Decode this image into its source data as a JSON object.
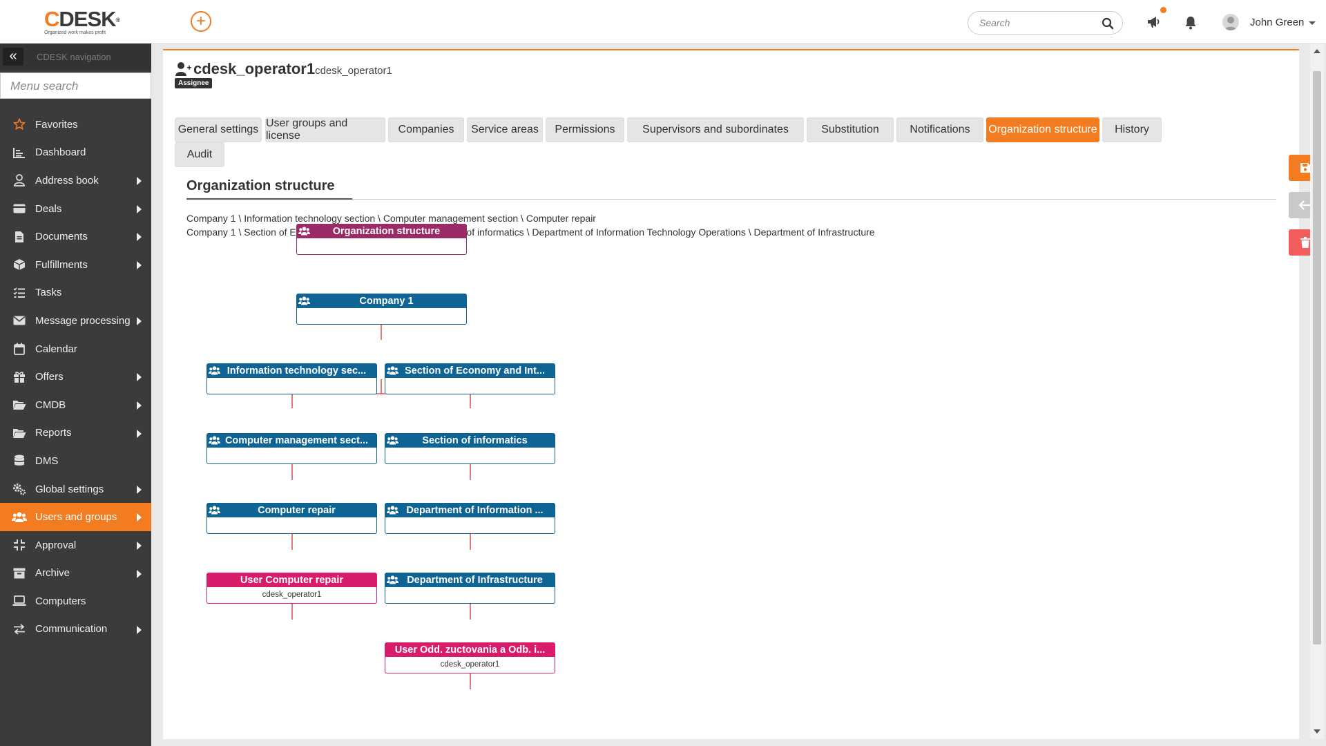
{
  "app": {
    "logo_text": "CDESK",
    "logo_tagline": "Organized work makes profit",
    "add_label": "+"
  },
  "topbar": {
    "search_placeholder": "Search",
    "user_name": "John Green",
    "icons": [
      "search-icon",
      "megaphone-icon",
      "bell-icon",
      "avatar"
    ]
  },
  "sidebar": {
    "toggle_label": "«",
    "nav_title": "CDESK navigation",
    "menu_search_placeholder": "Menu search",
    "items": [
      {
        "label": "Favorites",
        "icon": "star-icon",
        "has_submenu": false
      },
      {
        "label": "Dashboard",
        "icon": "dashboard-icon",
        "has_submenu": false
      },
      {
        "label": "Address book",
        "icon": "person-icon",
        "has_submenu": true
      },
      {
        "label": "Deals",
        "icon": "card-icon",
        "has_submenu": true
      },
      {
        "label": "Documents",
        "icon": "document-icon",
        "has_submenu": true
      },
      {
        "label": "Fulfillments",
        "icon": "box-icon",
        "has_submenu": true
      },
      {
        "label": "Tasks",
        "icon": "tasks-icon",
        "has_submenu": false
      },
      {
        "label": "Message processing",
        "icon": "envelope-icon",
        "has_submenu": true
      },
      {
        "label": "Calendar",
        "icon": "calendar-icon",
        "has_submenu": false
      },
      {
        "label": "Offers",
        "icon": "gift-icon",
        "has_submenu": true
      },
      {
        "label": "CMDB",
        "icon": "folder-open-icon",
        "has_submenu": true
      },
      {
        "label": "Reports",
        "icon": "folder-open-icon",
        "has_submenu": true
      },
      {
        "label": "DMS",
        "icon": "database-icon",
        "has_submenu": false
      },
      {
        "label": "Global settings",
        "icon": "gears-icon",
        "has_submenu": true
      },
      {
        "label": "Users and groups",
        "icon": "users-icon",
        "has_submenu": true,
        "active": true
      },
      {
        "label": "Approval",
        "icon": "compress-icon",
        "has_submenu": true
      },
      {
        "label": "Archive",
        "icon": "archive-icon",
        "has_submenu": true
      },
      {
        "label": "Computers",
        "icon": "laptop-icon",
        "has_submenu": false
      },
      {
        "label": "Communication",
        "icon": "exchange-icon",
        "has_submenu": true
      }
    ]
  },
  "header": {
    "title": "cdesk_operator1",
    "subtitle": "cdesk_operator1",
    "badge": "Assignee"
  },
  "tabs": [
    {
      "label": "General settings"
    },
    {
      "label": "User groups and license"
    },
    {
      "label": "Companies"
    },
    {
      "label": "Service areas"
    },
    {
      "label": "Permissions"
    },
    {
      "label": "Supervisors and subordinates"
    },
    {
      "label": "Substitution"
    },
    {
      "label": "Notifications"
    },
    {
      "label": "Organization structure",
      "active": true
    },
    {
      "label": "History"
    },
    {
      "label": "Audit"
    }
  ],
  "section": {
    "title": "Organization structure",
    "paths": [
      "Company 1 \\ Information technology section \\ Computer management section \\ Computer repair",
      "Company 1 \\ Section of Economy and Internal Services \\ Section of informatics \\ Department of Information Technology Operations \\ Department of Infrastructure"
    ]
  },
  "org_chart": {
    "nodes": [
      {
        "id": "root",
        "label": "Organization structure",
        "kind": "plum"
      },
      {
        "id": "company",
        "label": "Company 1",
        "kind": "blue"
      },
      {
        "id": "it",
        "label": "Information technology sec...",
        "kind": "blue"
      },
      {
        "id": "eco",
        "label": "Section of Economy and Int...",
        "kind": "blue"
      },
      {
        "id": "cms",
        "label": "Computer management sect...",
        "kind": "blue"
      },
      {
        "id": "inf",
        "label": "Section of informatics",
        "kind": "blue"
      },
      {
        "id": "cr",
        "label": "Computer repair",
        "kind": "blue"
      },
      {
        "id": "dito",
        "label": "Department of Information ...",
        "kind": "blue"
      },
      {
        "id": "ucr",
        "label": "User Computer repair",
        "kind": "user",
        "sub": "cdesk_operator1"
      },
      {
        "id": "dinf",
        "label": "Department of Infrastructure",
        "kind": "blue"
      },
      {
        "id": "uodd",
        "label": "User Odd. zuctovania a Odb. i...",
        "kind": "user",
        "sub": "cdesk_operator1"
      }
    ]
  },
  "actions": {
    "save_icon": "save-icon",
    "back_icon": "arrow-left-icon",
    "delete_icon": "trash-icon"
  },
  "colors": {
    "accent": "#f47c20",
    "node_blue": "#0e6494",
    "node_plum": "#9c2a67",
    "node_user": "#d81b6a",
    "connector": "#e05555",
    "sidebar_bg": "#3b3b3b",
    "danger": "#f25c5c"
  }
}
